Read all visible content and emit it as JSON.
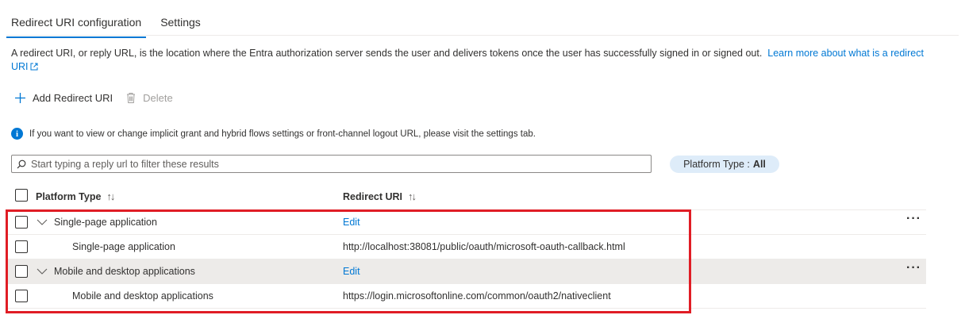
{
  "tabs": [
    {
      "label": "Redirect URI configuration",
      "active": true
    },
    {
      "label": "Settings",
      "active": false
    }
  ],
  "description": {
    "text": "A redirect URI, or reply URL, is the location where the Entra authorization server sends the user and delivers tokens once the user has successfully signed in or signed out.",
    "link_text": "Learn more about what is a redirect URI"
  },
  "toolbar": {
    "add_label": "Add Redirect URI",
    "delete_label": "Delete"
  },
  "info_message": "If you want to view or change implicit grant and hybrid flows settings or front-channel logout URL, please visit the settings tab.",
  "filter": {
    "placeholder": "Start typing a reply url to filter these results",
    "value": ""
  },
  "platform_filter": {
    "label": "Platform Type :",
    "value": "All"
  },
  "columns": {
    "platform_type": "Platform Type",
    "redirect_uri": "Redirect URI",
    "sort_glyph": "↑↓"
  },
  "groups": [
    {
      "label": "Single-page application",
      "action": "Edit",
      "more": "···",
      "child": {
        "label": "Single-page application",
        "uri": "http://localhost:38081/public/oauth/microsoft-oauth-callback.html"
      }
    },
    {
      "label": "Mobile and desktop applications",
      "action": "Edit",
      "more": "···",
      "child": {
        "label": "Mobile and desktop applications",
        "uri": "https://login.microsoftonline.com/common/oauth2/nativeclient"
      }
    }
  ],
  "colors": {
    "accent": "#0078d4",
    "highlight_border": "#e01d25",
    "selected_row_bg": "#edebe9",
    "pill_bg": "#deecf9"
  },
  "icons": [
    "external-link-icon",
    "add-icon",
    "trash-icon",
    "info-icon",
    "search-icon",
    "chevron-down-icon",
    "more-icon"
  ]
}
